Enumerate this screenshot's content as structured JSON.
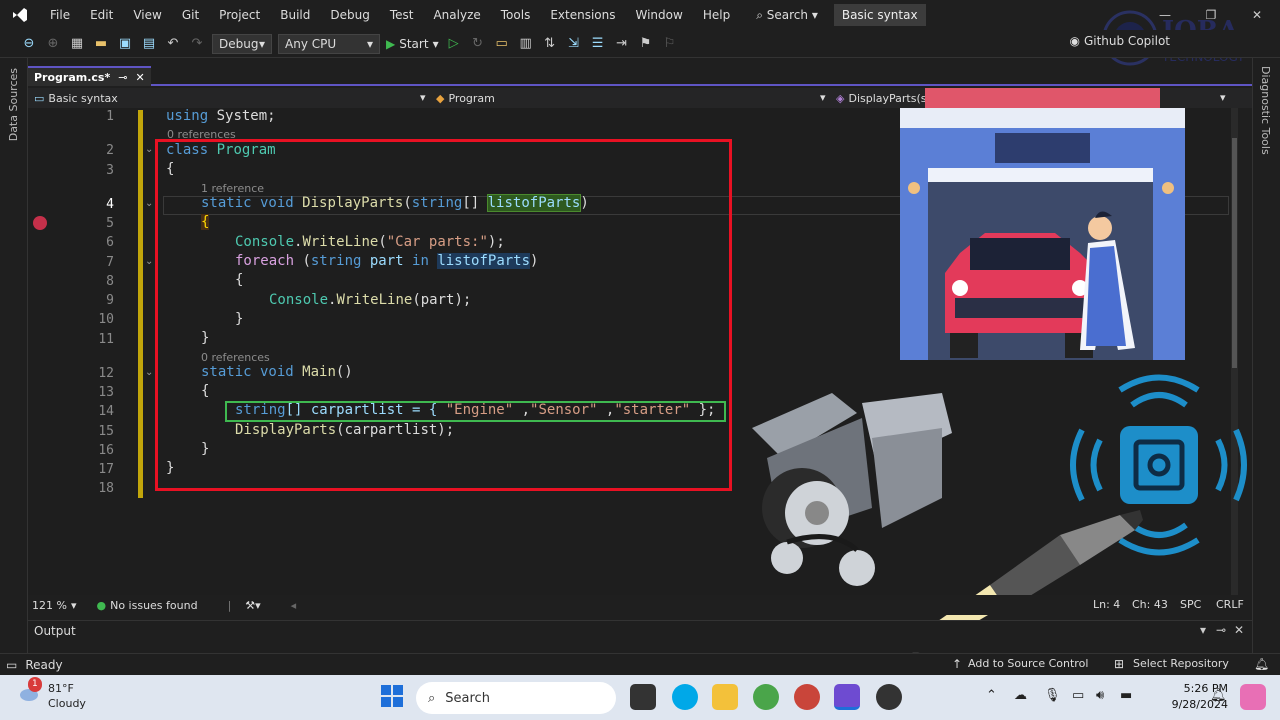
{
  "menubar": {
    "items": [
      "File",
      "Edit",
      "View",
      "Git",
      "Project",
      "Build",
      "Debug",
      "Test",
      "Analyze",
      "Tools",
      "Extensions",
      "Window",
      "Help"
    ],
    "search": "Search",
    "solution": "Basic syntax"
  },
  "toolbar": {
    "config": "Debug",
    "platform": "Any CPU",
    "start": "Start",
    "copilot": "Github Copilot"
  },
  "side": {
    "left": "Data Sources",
    "right": "Diagnostic Tools"
  },
  "tab": {
    "label": "Program.cs*"
  },
  "navbar": {
    "project": "Basic syntax",
    "type": "Program",
    "member": "DisplayParts(st"
  },
  "editor": {
    "line_numbers": [
      "1",
      "2",
      "3",
      "4",
      "5",
      "6",
      "7",
      "8",
      "9",
      "10",
      "11",
      "12",
      "13",
      "14",
      "15",
      "16",
      "17",
      "18"
    ],
    "codelens": {
      "c1": "0 references",
      "c2": "1 reference",
      "c3": "0 references"
    },
    "code": {
      "l1a": "using",
      "l1b": " System;",
      "l2a": "class",
      "l2b": " Program",
      "l3": "{",
      "l4a": "static",
      "l4b": " void ",
      "l4c": "DisplayParts",
      "l4d": "(",
      "l4e": "string",
      "l4f": "[] ",
      "l4g": "listofParts",
      "l4h": ")",
      "l5": "{",
      "l6a": "Console",
      "l6b": ".",
      "l6c": "WriteLine",
      "l6d": "(",
      "l6e": "\"Car parts:\"",
      "l6f": ");",
      "l7a": "foreach",
      "l7b": " (",
      "l7c": "string",
      "l7d": " part ",
      "l7e": "in",
      "l7f": " ",
      "l7g": "listofParts",
      "l7h": ")",
      "l8": "{",
      "l9a": "Console",
      "l9b": ".",
      "l9c": "WriteLine",
      "l9d": "(part);",
      "l10": "}",
      "l11": "}",
      "l12a": "static",
      "l12b": " void ",
      "l12c": "Main",
      "l12d": "()",
      "l13": "{",
      "l14a": "string",
      "l14b": "[] carpartlist = { ",
      "l14c": "\"Engine\"",
      "l14d": " ,",
      "l14e": "\"Sensor\"",
      "l14f": " ,",
      "l14g": "\"starter\"",
      "l14h": " };",
      "l15a": "DisplayParts",
      "l15b": "(carpartlist);",
      "l16": "}",
      "l17": "}"
    }
  },
  "editor_status": {
    "zoom": "121 %",
    "issues": "No issues found",
    "ln": "Ln: 4",
    "ch": "Ch: 43",
    "spc": "SPC",
    "crlf": "CRLF"
  },
  "output": {
    "title": "Output"
  },
  "status": {
    "ready": "Ready",
    "source_control": "Add to Source Control",
    "repo": "Select Repository"
  },
  "taskbar": {
    "temp": "81°F",
    "weather": "Cloudy",
    "search": "Search",
    "time": "5:26 PM",
    "date": "9/28/2024",
    "badge": "1"
  },
  "watermark": {
    "line1": "IQRA",
    "line2": "TECHNOLOGY"
  }
}
